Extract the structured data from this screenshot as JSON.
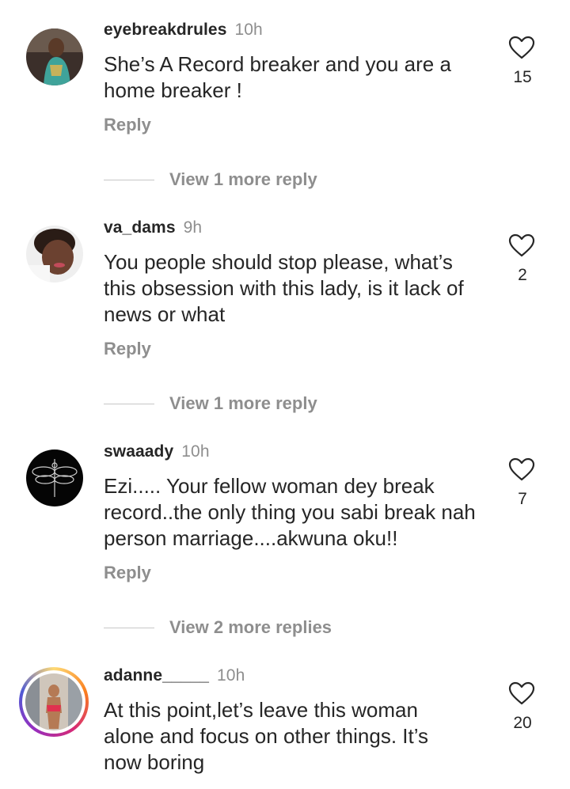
{
  "comments": [
    {
      "username": "eyebreakdrules",
      "time": "10h",
      "text": "She’s A Record breaker and you are a home breaker !",
      "reply_label": "Reply",
      "likes": "15",
      "view_more": "View 1 more reply"
    },
    {
      "username": "va_dams",
      "time": "9h",
      "text": "You people should stop please, what’s this obsession with this lady, is it lack of news or what",
      "reply_label": "Reply",
      "likes": "2",
      "view_more": "View 1 more reply"
    },
    {
      "username": "swaaady",
      "time": "10h",
      "text": "Ezi..... Your fellow woman dey break record..the only thing you sabi break nah person marriage....akwuna oku!!",
      "reply_label": "Reply",
      "likes": "7",
      "view_more": "View 2 more replies"
    },
    {
      "username": "adanne_____",
      "time": "10h",
      "text": "At this point,let’s leave this woman alone and focus on other things. It’s now boring",
      "likes": "20"
    }
  ],
  "icons": {
    "like": "heart-outline-icon"
  },
  "colors": {
    "text": "#262626",
    "secondary": "#8e8e8e",
    "divider": "#c7c7c7"
  }
}
